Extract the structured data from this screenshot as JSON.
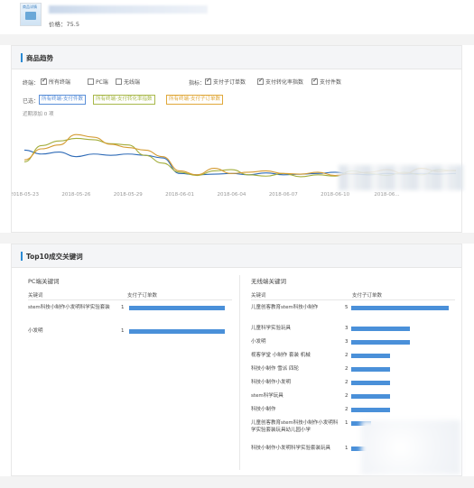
{
  "product": {
    "thumb_text": "商品详情",
    "price_label": "价格：75.5"
  },
  "trend_panel": {
    "title": "商品趋势",
    "terminal_label": "终端：",
    "terminal_options": [
      {
        "label": "所有终端",
        "checked": true
      },
      {
        "label": "PC端",
        "checked": false
      },
      {
        "label": "无线端",
        "checked": false
      }
    ],
    "metric_label": "指标：",
    "metric_options": [
      {
        "label": "支付子订单数",
        "checked": true
      },
      {
        "label": "支付转化率指数",
        "checked": true
      },
      {
        "label": "支付件数",
        "checked": true
      }
    ],
    "selected_label": "已选：",
    "selected_tags": [
      {
        "label": "所有终端-支付件数",
        "color": "#5a8fd8"
      },
      {
        "label": "所有终端-支付转化率指数",
        "color": "#a8b84a"
      },
      {
        "label": "所有终端-支付子订单数",
        "color": "#e0a83a"
      }
    ],
    "recent_label": "近期添加 0 项"
  },
  "chart_data": {
    "type": "line",
    "x": [
      "2018-05-23",
      "2018-05-24",
      "2018-05-25",
      "2018-05-26",
      "2018-05-27",
      "2018-05-28",
      "2018-05-29",
      "2018-05-30",
      "2018-05-31",
      "2018-06-01",
      "2018-06-02",
      "2018-06-03",
      "2018-06-04",
      "2018-06-05",
      "2018-06-06",
      "2018-06-07",
      "2018-06-08",
      "2018-06-09",
      "2018-06-10",
      "2018-06-11",
      "2018-06-12",
      "2018-06-13",
      "2018-06-14",
      "2018-06-15",
      "2018-06-16",
      "2018-06-17"
    ],
    "xtick_labels": [
      "2018-05-23",
      "2018-05-26",
      "2018-05-29",
      "2018-06-01",
      "2018-06-04",
      "2018-06-07",
      "2018-06-10",
      "2018-06..."
    ],
    "xtick_index": [
      0,
      3,
      6,
      9,
      12,
      15,
      18,
      21
    ],
    "ylim": [
      0,
      100
    ],
    "series": [
      {
        "name": "所有终端-支付件数",
        "color": "#2f6bb7",
        "values": [
          48,
          42,
          45,
          38,
          42,
          40,
          42,
          40,
          36,
          12,
          10,
          11,
          12,
          10,
          13,
          10,
          11,
          12,
          14,
          11,
          10,
          12,
          11,
          12,
          11,
          12
        ]
      },
      {
        "name": "所有终端-支付转化率指数",
        "color": "#a3ae3c",
        "values": [
          30,
          55,
          62,
          66,
          64,
          58,
          56,
          40,
          28,
          14,
          9,
          16,
          18,
          10,
          8,
          12,
          7,
          10,
          8,
          16,
          12,
          9,
          14,
          10,
          18,
          16
        ]
      },
      {
        "name": "所有终端-支付子订单数",
        "color": "#d49a30",
        "values": [
          33,
          50,
          56,
          72,
          68,
          57,
          52,
          48,
          38,
          16,
          10,
          20,
          12,
          14,
          16,
          12,
          11,
          14,
          9,
          12,
          14,
          18,
          12,
          20,
          15,
          17
        ]
      }
    ]
  },
  "keywords_panel": {
    "title": "Top10成交关键词",
    "pc": {
      "title": "PC端关键词",
      "col_keyword": "关键词",
      "col_count": "支付子订单数",
      "rows": [
        {
          "keyword": "stem科技小制作小发明科学实验套装",
          "count": "1",
          "value": 1
        },
        {
          "keyword": "小发明",
          "count": "1",
          "value": 1
        }
      ]
    },
    "mobile": {
      "title": "无线端关键词",
      "col_keyword": "关键词",
      "col_count": "支付子订单数",
      "rows": [
        {
          "keyword": "儿童创客教育stem科技小制作",
          "count": "5",
          "value": 5
        },
        {
          "keyword": "儿童科学实验玩具",
          "count": "3",
          "value": 3
        },
        {
          "keyword": "小发明",
          "count": "3",
          "value": 3
        },
        {
          "keyword": "视客学堂 小制作 套装 机械",
          "count": "2",
          "value": 2
        },
        {
          "keyword": "科技小制作 雪派 四轮",
          "count": "2",
          "value": 2
        },
        {
          "keyword": "科技小制作小发明",
          "count": "2",
          "value": 2
        },
        {
          "keyword": "stem科学玩具",
          "count": "2",
          "value": 2
        },
        {
          "keyword": "科技小制作",
          "count": "2",
          "value": 2
        },
        {
          "keyword": "儿童创客教育stem科技小制作小发明科学实验套装玩具幼儿园小学",
          "count": "1",
          "value": 1
        },
        {
          "keyword": "科技小制作小发明科学实验套装玩具",
          "count": "1",
          "value": 1
        }
      ]
    }
  }
}
